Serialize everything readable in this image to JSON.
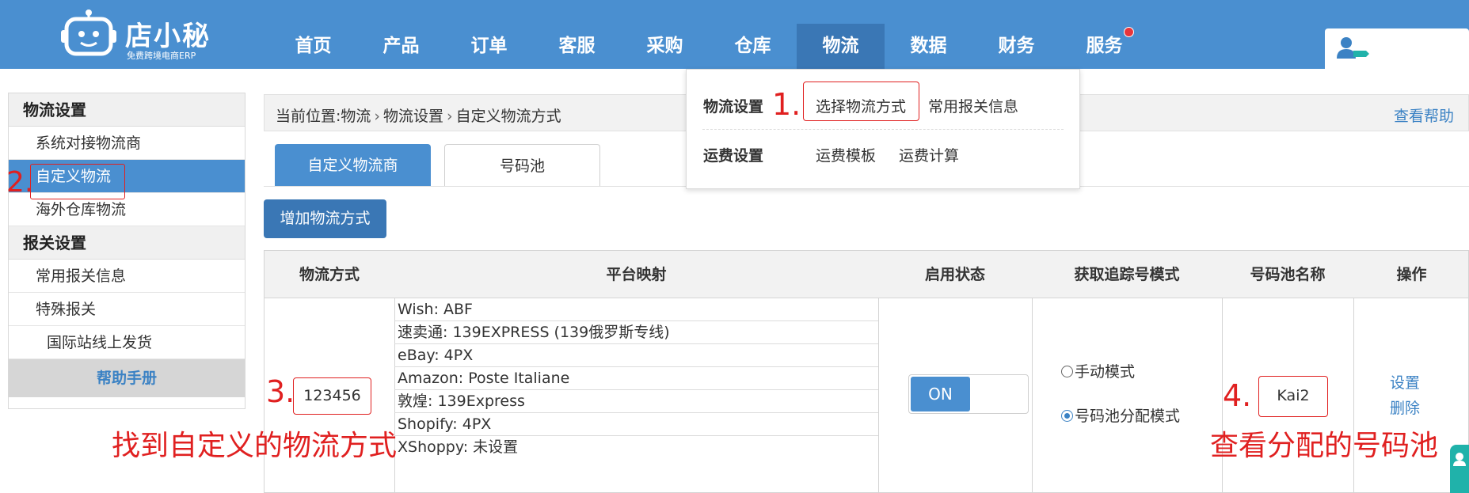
{
  "header": {
    "logo_text": "店小秘",
    "logo_subtitle": "免费跨境电商ERP",
    "nav": [
      {
        "label": "首页"
      },
      {
        "label": "产品"
      },
      {
        "label": "订单"
      },
      {
        "label": "客服"
      },
      {
        "label": "采购"
      },
      {
        "label": "仓库"
      },
      {
        "label": "物流",
        "active": true
      },
      {
        "label": "数据"
      },
      {
        "label": "财务"
      },
      {
        "label": "服务",
        "badge": true
      }
    ],
    "user_icon": "user-card-icon"
  },
  "dropdown": {
    "group1_label": "物流设置",
    "group1_link1": "选择物流方式",
    "group1_link2": "常用报关信息",
    "group2_label": "运费设置",
    "group2_link1": "运费模板",
    "group2_link2": "运费计算"
  },
  "sidebar": {
    "group1_title": "物流设置",
    "item1": "系统对接物流商",
    "item2": "自定义物流",
    "item3": "海外仓库物流",
    "group2_title": "报关设置",
    "item4": "常用报关信息",
    "item5": "特殊报关",
    "item6": "国际站线上发货",
    "help": "帮助手册"
  },
  "breadcrumb": {
    "prefix": "当前位置:",
    "level1": "物流",
    "level2": "物流设置",
    "level3": "自定义物流方式",
    "help_link": "查看帮助"
  },
  "tabs": {
    "active": "自定义物流商",
    "inactive": "号码池"
  },
  "add_button": "增加物流方式",
  "table": {
    "headers": {
      "method": "物流方式",
      "mapping": "平台映射",
      "status": "启用状态",
      "tracking_mode": "获取追踪号模式",
      "pool_name": "号码池名称",
      "actions": "操作"
    },
    "row": {
      "method": "123456",
      "mappings": [
        "Wish: ABF",
        "速卖通: 139EXPRESS (139俄罗斯专线)",
        "eBay: 4PX",
        "Amazon: Poste Italiane",
        "敦煌: 139Express",
        "Shopify: 4PX",
        "XShoppy: 未设置"
      ],
      "status_toggle": "ON",
      "mode_manual": "手动模式",
      "mode_pool": "号码池分配模式",
      "mode_selected": "pool",
      "pool_name": "Kai2",
      "action_settings": "设置",
      "action_delete": "删除"
    }
  },
  "annotations": {
    "step1": "1.",
    "step2": "2.",
    "step3": "3.",
    "step4": "4.",
    "caption3": "找到自定义的物流方式",
    "caption4": "查看分配的号码池"
  },
  "colors": {
    "brand_blue": "#4a8fd0",
    "active_blue": "#3a77b5",
    "link_blue": "#3b82c4",
    "annotation_red": "#e02020"
  }
}
